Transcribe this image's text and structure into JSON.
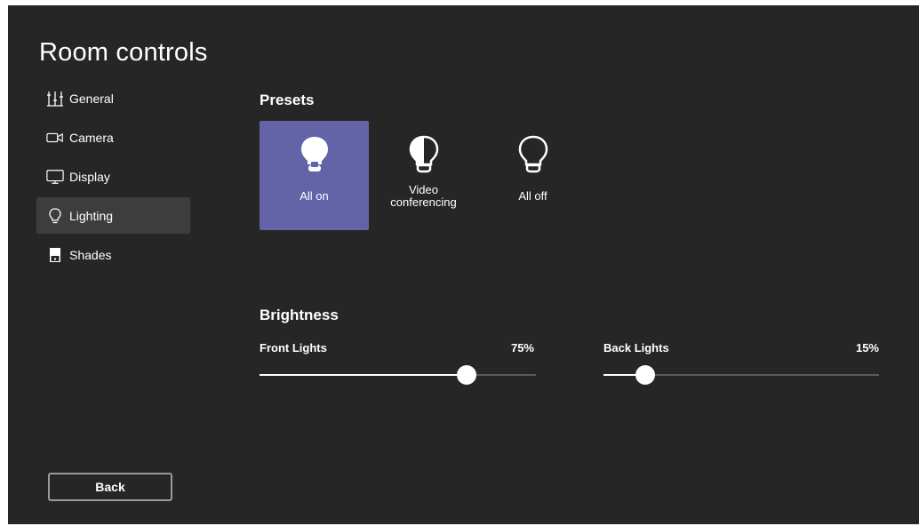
{
  "window": {
    "title": "Room controls"
  },
  "nav": {
    "items": [
      {
        "label": "General",
        "icon": "sliders-icon",
        "active": false
      },
      {
        "label": "Camera",
        "icon": "camera-icon",
        "active": false
      },
      {
        "label": "Display",
        "icon": "monitor-icon",
        "active": false
      },
      {
        "label": "Lighting",
        "icon": "lightbulb-icon",
        "active": true
      },
      {
        "label": "Shades",
        "icon": "shades-icon",
        "active": false
      }
    ]
  },
  "presets": {
    "title": "Presets",
    "items": [
      {
        "label": "All on",
        "icon": "lightbulb-filled-icon",
        "active": true
      },
      {
        "label_line1": "Video",
        "label_line2": "conferencing",
        "icon": "lightbulb-half-icon",
        "active": false
      },
      {
        "label": "All off",
        "icon": "lightbulb-outline-icon",
        "active": false
      }
    ]
  },
  "brightness": {
    "title": "Brightness",
    "sliders": [
      {
        "label": "Front Lights",
        "value_text": "75%",
        "value": 0.75
      },
      {
        "label": "Back Lights",
        "value_text": "15%",
        "value": 0.15
      }
    ]
  },
  "footer": {
    "back_label": "Back"
  },
  "colors": {
    "background": "#272626",
    "accent": "#6264a7",
    "nav_active": "#3d3d3d"
  }
}
